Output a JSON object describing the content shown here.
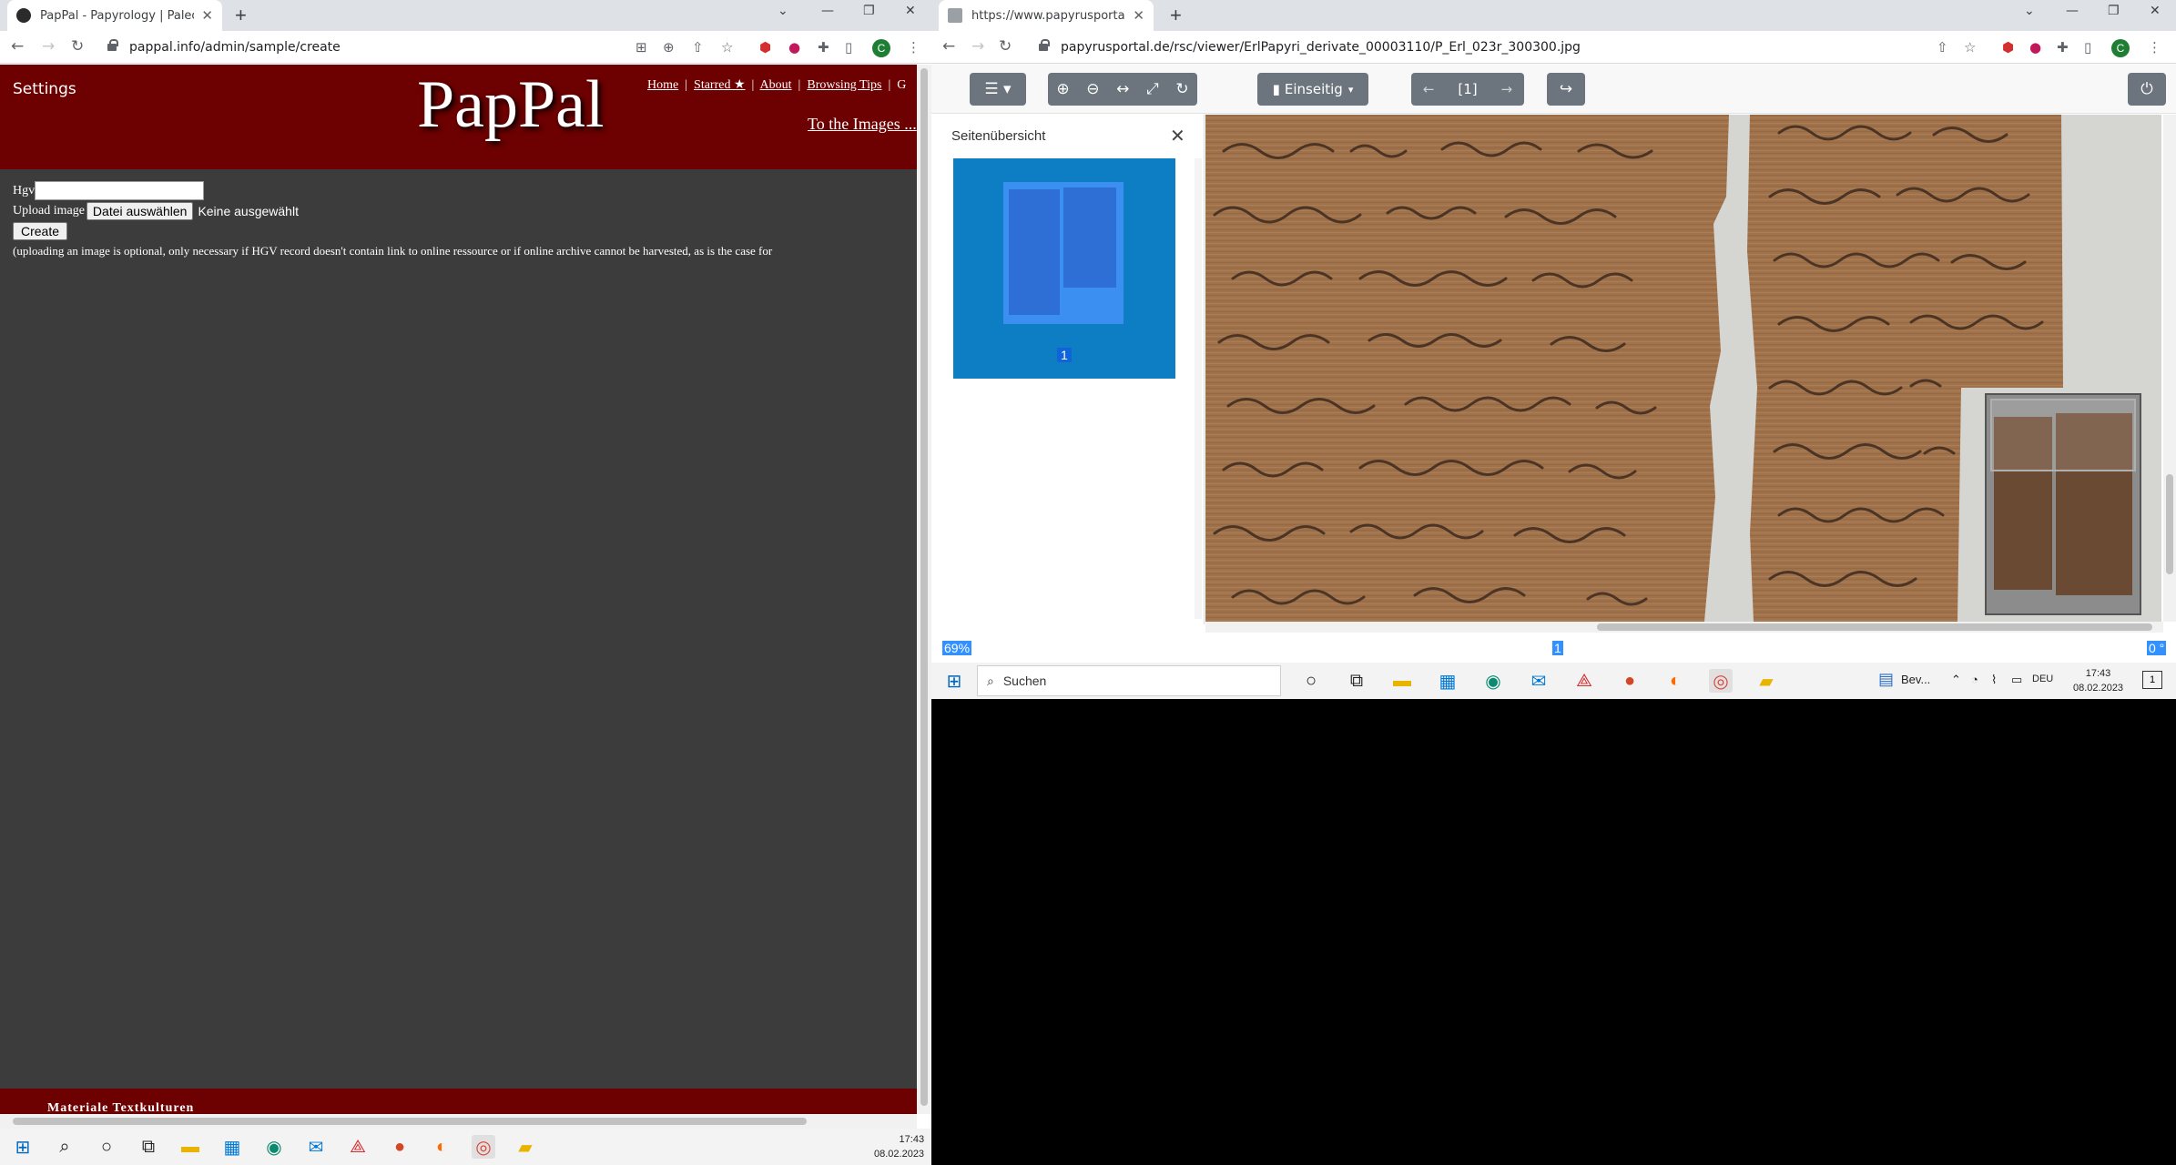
{
  "left_window": {
    "tab_title": "PapPal - Papyrology | Paleographic",
    "url": "pappal.info/admin/sample/create",
    "header": {
      "settings": "Settings",
      "logo": "PapPal",
      "nav": [
        "Home",
        "Starred ★",
        "About",
        "Browsing Tips"
      ],
      "to_images": "To the Images ..."
    },
    "form": {
      "hgv_label": "Hgv",
      "hgv_value": "",
      "upload_label": "Upload image",
      "file_button": "Datei auswählen",
      "file_status": "Keine ausgewählt",
      "create_button": "Create",
      "note": "(uploading an image is optional, only necessary if HGV record doesn't contain link to online ressource or if online archive cannot be harvested, as is the case for"
    },
    "footer": "Materiale Textkulturen"
  },
  "right_window": {
    "tab_title": "https://www.papyrusportal.de/rsc",
    "url": "papyrusportal.de/rsc/viewer/ErlPapyri_derivate_00003110/P_Erl_023r_300300.jpg",
    "viewer": {
      "view_mode": "Einseitig",
      "page_indicator": "[1]",
      "sidebar_title": "Seitenübersicht",
      "thumb_number": "1",
      "zoom_display": "69%",
      "page_bar_number": "1",
      "rotation_display": "0 °"
    }
  },
  "taskbar_right": {
    "search_placeholder": "Suchen",
    "pinned_label": "Bev...",
    "language": "DEU",
    "time": "17:43",
    "date": "08.02.2023",
    "notification_count": "1"
  },
  "taskbar_left": {
    "time": "17:43",
    "date": "08.02.2023"
  },
  "colors": {
    "pappal_red": "#6d0000",
    "pappal_body": "#3c3c3c",
    "viewer_button": "#6c757d",
    "thumb_blue": "#0d7ec4"
  }
}
